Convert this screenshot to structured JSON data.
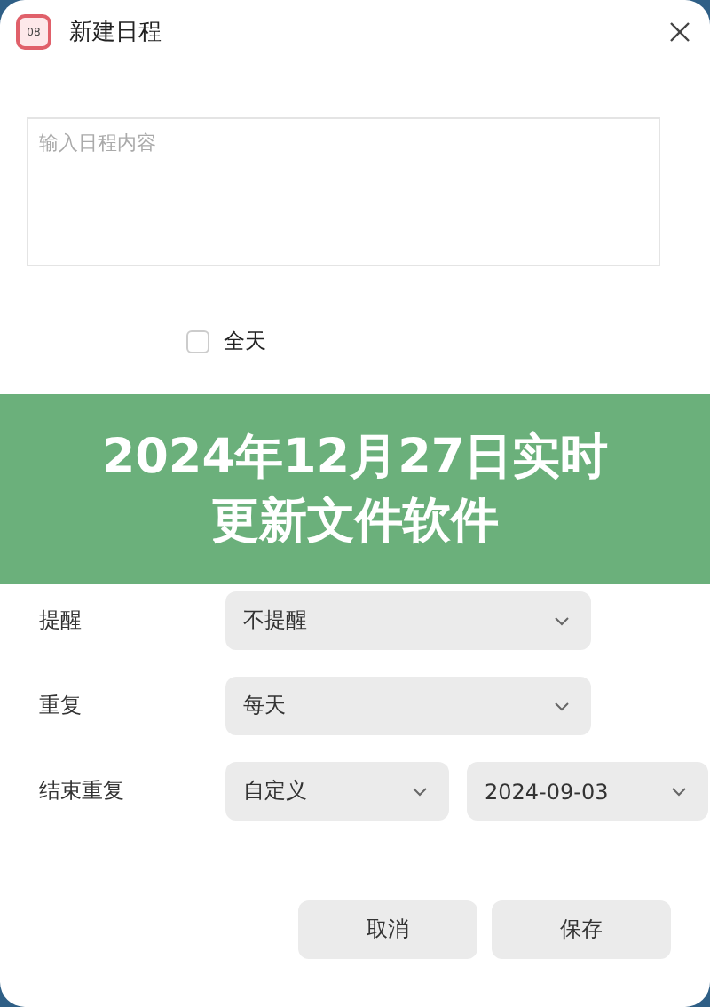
{
  "window": {
    "icon_text": "08",
    "title": "新建日程"
  },
  "content_field": {
    "placeholder": "输入日程内容"
  },
  "all_day": {
    "label": "全天",
    "checked": false
  },
  "rows": [
    {
      "label": "提醒",
      "selects": [
        {
          "value": "不提醒"
        }
      ]
    },
    {
      "label": "重复",
      "selects": [
        {
          "value": "每天"
        }
      ]
    },
    {
      "label": "结束重复",
      "selects": [
        {
          "value": "自定义"
        },
        {
          "value": "2024-09-03"
        }
      ]
    }
  ],
  "buttons": [
    "取消",
    "保存"
  ],
  "banner": {
    "lines": [
      "2024年12月27日实时",
      "更新文件软件"
    ]
  }
}
